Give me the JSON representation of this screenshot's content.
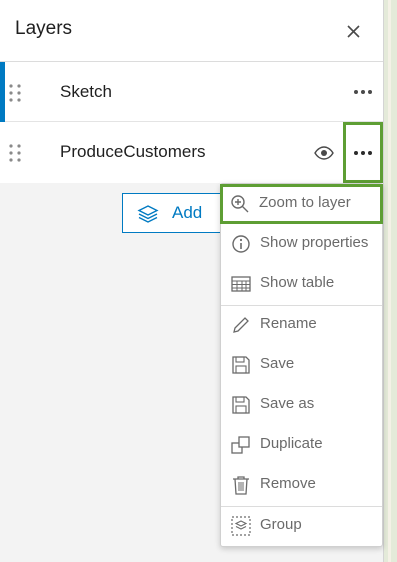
{
  "header": {
    "title": "Layers",
    "close_icon": "close-icon"
  },
  "layers": [
    {
      "name": "Sketch",
      "active": true,
      "visibility_shown": false
    },
    {
      "name": "ProduceCustomers",
      "active": false,
      "visibility_shown": true
    }
  ],
  "add_button": {
    "label": "Add",
    "icon": "layers-add-icon"
  },
  "context_menu": {
    "items": [
      {
        "label": "Zoom to layer",
        "icon": "zoom-in-icon",
        "highlighted": true
      },
      {
        "label": "Show properties",
        "icon": "info-icon"
      },
      {
        "label": "Show table",
        "icon": "table-icon"
      },
      {
        "label": "Rename",
        "icon": "pencil-icon"
      },
      {
        "label": "Save",
        "icon": "save-icon"
      },
      {
        "label": "Save as",
        "icon": "save-as-icon"
      },
      {
        "label": "Duplicate",
        "icon": "duplicate-icon"
      },
      {
        "label": "Remove",
        "icon": "trash-icon"
      },
      {
        "label": "Group",
        "icon": "group-icon"
      }
    ]
  },
  "colors": {
    "accent": "#007ac2",
    "highlight_border": "#5e9e34",
    "menu_text": "#6a6a6a"
  }
}
